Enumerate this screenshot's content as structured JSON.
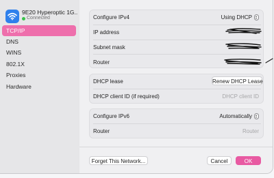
{
  "network": {
    "name": "9E20 Hyperoptic 1G...",
    "status": "Connected",
    "icon": "wifi-icon",
    "status_color": "#3ac24a"
  },
  "sidebar": {
    "items": [
      {
        "label": "TCP/IP",
        "active": true
      },
      {
        "label": "DNS"
      },
      {
        "label": "WINS"
      },
      {
        "label": "802.1X"
      },
      {
        "label": "Proxies"
      },
      {
        "label": "Hardware"
      }
    ]
  },
  "ipv4": {
    "configure_label": "Configure IPv4",
    "configure_value": "Using DHCP",
    "ip_label": "IP address",
    "subnet_label": "Subnet mask",
    "router_label": "Router"
  },
  "dhcp": {
    "lease_label": "DHCP lease",
    "renew_button": "Renew DHCP Lease",
    "client_id_label": "DHCP client ID (if required)",
    "client_id_placeholder": "DHCP client ID"
  },
  "ipv6": {
    "configure_label": "Configure IPv6",
    "configure_value": "Automatically",
    "router_label": "Router",
    "router_placeholder": "Router"
  },
  "footer": {
    "forget_button": "Forget This Network...",
    "cancel_button": "Cancel",
    "ok_button": "OK"
  },
  "colors": {
    "accent": "#e85aa2",
    "sidebar_active": "#ee6fac",
    "wifi_badge": "#2f80ec"
  }
}
